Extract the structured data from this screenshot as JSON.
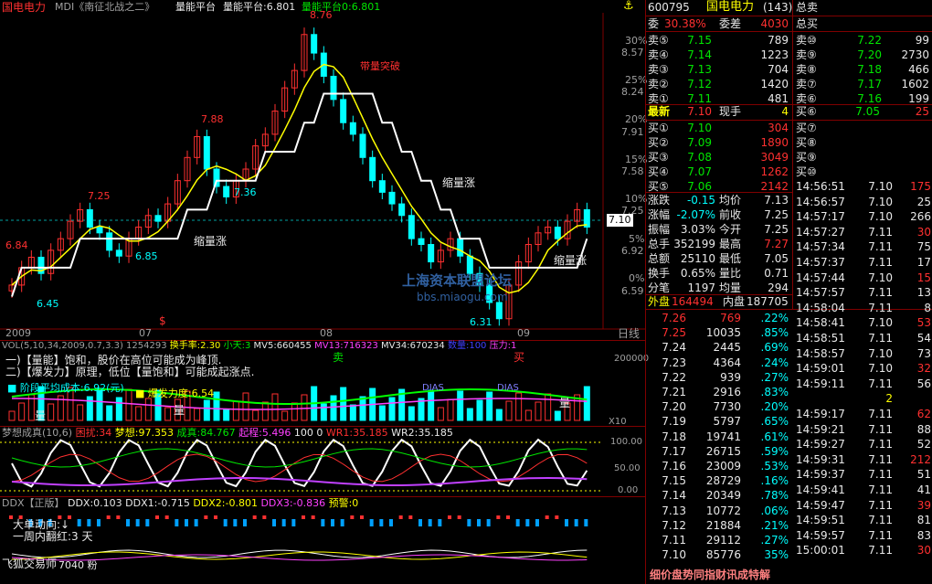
{
  "title_bar": {
    "stock_name": "国电电力",
    "indicator": "MDI《南征北战之二》",
    "platform_label": "量能平台",
    "platform_value": "量能平台:6.801",
    "platform_value2": "量能平台0:6.801",
    "top_right_icon": "anchor-icon"
  },
  "main_chart": {
    "right_scale": [
      "30%",
      "8.57",
      "25%",
      "8.24",
      "20%",
      "7.91",
      "15%",
      "7.58",
      "10%",
      "7.25",
      "5%",
      "6.92",
      "0%",
      "6.59"
    ],
    "price_marker": "7.10",
    "labels": {
      "high_876": "8.76",
      "l788": "7.88",
      "l736": "7.36",
      "l725": "7.25",
      "l684": "6.84",
      "l685": "6.85",
      "l645": "6.45",
      "l631": "6.31",
      "txt_shrink1": "缩量涨",
      "txt_shrink2": "缩量涨",
      "txt_shrink3": "缩量涨",
      "txt_platform": "带量突破",
      "watermark1": "上海资本联盟论坛",
      "watermark2": "bbs.miaogu.com",
      "dollar": "$"
    },
    "x_labels": [
      "2009",
      "07",
      "08",
      "09"
    ],
    "daily": "日线",
    "chart_data": {
      "type": "candlestick",
      "y_range": [
        6.3,
        8.9
      ],
      "close": [
        6.6,
        6.75,
        6.84,
        6.7,
        6.9,
        7.0,
        7.15,
        7.25,
        7.1,
        7.05,
        6.9,
        6.85,
        7.0,
        7.1,
        7.2,
        7.15,
        7.3,
        7.5,
        7.7,
        7.88,
        7.6,
        7.45,
        7.36,
        7.5,
        7.6,
        7.8,
        7.9,
        8.1,
        8.3,
        8.45,
        8.76,
        8.6,
        8.4,
        8.2,
        8.0,
        7.9,
        7.7,
        7.5,
        7.4,
        7.3,
        7.2,
        7.0,
        6.95,
        6.8,
        6.9,
        7.0,
        6.85,
        6.7,
        6.6,
        6.45,
        6.31,
        6.6,
        6.8,
        6.95,
        7.05,
        7.1,
        7.0,
        7.15,
        7.25,
        7.1
      ]
    }
  },
  "vol_panel": {
    "header": "VOL(5,10,34,2009,0.7,3.3) 1254293",
    "turnover": "换手率:2.30",
    "small_days": "小天:3",
    "mv5": "MV5:660455",
    "mv13": "MV13:716323",
    "mv34": "MV34:670234",
    "qty": "数量:100",
    "pressure": "压力:1",
    "line1": "一)【量能】饱和，股价在高位可能成为峰顶.",
    "line2": "二)【爆发力】原理，低位【量饱和】可能成起涨点.",
    "stage_cost": "阶段平均成本:6.92(元)",
    "burst": "爆发力度:6.54",
    "scale_200000": "200000",
    "x10": "X10",
    "sell_label": "卖",
    "sell2": "卖",
    "buy_label": "买",
    "low_label1": "量",
    "low_label2": "量",
    "low_label3": "量",
    "dif_label1": "DIAS",
    "dif_label2": "DIAS"
  },
  "dream_panel": {
    "header": "梦想成真(10,6)",
    "guolu": "困扰:34",
    "dream": "梦想:97.353",
    "cheng": "成真:84.767",
    "qicheng": "起程:5.496",
    "hundred": "100",
    "zero": "0",
    "wr1": "WR1:35.185",
    "wr2": "WR2:35.185",
    "s100": "100.00",
    "s50": "50.00",
    "s0": "0.00"
  },
  "ddx_panel": {
    "header": "DDX【正版】",
    "ddx": "DDX:0.103",
    "ddx1": "DDX1:-0.715",
    "ddx2": "DDX2:-0.801",
    "ddx3": "DDX3:-0.836",
    "warn": "预警:0",
    "big_move": "大单动向:↓",
    "week_red": "一周内翻红:3 天",
    "trader": "飞狐交易师",
    "trader_val": "7040 粉"
  },
  "quote": {
    "code": "600795",
    "name": "国电电力",
    "name_count": "(143)",
    "total_sell": "总卖",
    "wei_bi_label": "委",
    "wei_bi": "30.38%",
    "wei_cha_label": "委差",
    "wei_cha": "4030",
    "total_buy": "总买",
    "sells": [
      {
        "l": "卖⑤",
        "p": "7.15",
        "v": "789"
      },
      {
        "l": "卖④",
        "p": "7.14",
        "v": "1223"
      },
      {
        "l": "卖③",
        "p": "7.13",
        "v": "704"
      },
      {
        "l": "卖②",
        "p": "7.12",
        "v": "1420"
      },
      {
        "l": "卖①",
        "p": "7.11",
        "v": "481"
      }
    ],
    "sells_r": [
      {
        "l": "卖⑩",
        "p": "7.22",
        "v": "99"
      },
      {
        "l": "卖⑨",
        "p": "7.20",
        "v": "2730"
      },
      {
        "l": "卖⑧",
        "p": "7.18",
        "v": "466"
      },
      {
        "l": "卖⑦",
        "p": "7.17",
        "v": "1602"
      },
      {
        "l": "卖⑥",
        "p": "7.16",
        "v": "199"
      }
    ],
    "latest_label": "最新",
    "latest": "7.10",
    "hand_label": "现手",
    "hand": "4",
    "buy6": {
      "l": "买⑥",
      "p": "7.05",
      "v": "25"
    },
    "buys": [
      {
        "l": "买①",
        "p": "7.10",
        "v": "304"
      },
      {
        "l": "买②",
        "p": "7.09",
        "v": "1890"
      },
      {
        "l": "买③",
        "p": "7.08",
        "v": "3049"
      },
      {
        "l": "买④",
        "p": "7.07",
        "v": "1262"
      },
      {
        "l": "买⑤",
        "p": "7.06",
        "v": "2142"
      }
    ],
    "buys_r": [
      "买⑦",
      "买⑧",
      "买⑨",
      "买⑩"
    ],
    "stats": [
      {
        "a": "涨跌",
        "av": "-0.15",
        "b": "均价",
        "bv": "7.13"
      },
      {
        "a": "涨幅",
        "av": "-2.07%",
        "b": "前收",
        "bv": "7.25"
      },
      {
        "a": "振幅",
        "av": "3.03%",
        "b": "今开",
        "bv": "7.25"
      },
      {
        "a": "总手",
        "av": "352199",
        "b": "最高",
        "bv": "7.27"
      },
      {
        "a": "总额",
        "av": "25110",
        "b": "最低",
        "bv": "7.05"
      },
      {
        "a": "换手",
        "av": "0.65%",
        "b": "量比",
        "bv": "0.71"
      },
      {
        "a": "分笔",
        "av": "1197",
        "b": "均量",
        "bv": "294"
      }
    ],
    "outer_label": "外盘",
    "outer": "164494",
    "inner_label": "内盘",
    "inner": "187705",
    "depth": [
      {
        "p": "7.26",
        "v": "769",
        "r": ".22%"
      },
      {
        "p": "7.25",
        "v": "10035",
        "r": ".85%"
      },
      {
        "p": "7.24",
        "v": "2445",
        "r": ".69%"
      },
      {
        "p": "7.23",
        "v": "4364",
        "r": ".24%"
      },
      {
        "p": "7.22",
        "v": "939",
        "r": ".27%"
      },
      {
        "p": "7.21",
        "v": "2916",
        "r": ".83%"
      },
      {
        "p": "7.20",
        "v": "7730",
        "r": ".20%"
      },
      {
        "p": "7.19",
        "v": "5797",
        "r": ".65%"
      },
      {
        "p": "7.18",
        "v": "19741",
        "r": ".61%"
      },
      {
        "p": "7.17",
        "v": "26715",
        "r": ".59%"
      },
      {
        "p": "7.16",
        "v": "23009",
        "r": ".53%"
      },
      {
        "p": "7.15",
        "v": "28729",
        "r": ".16%"
      },
      {
        "p": "7.14",
        "v": "20349",
        "r": ".78%"
      },
      {
        "p": "7.13",
        "v": "10772",
        "r": ".06%"
      },
      {
        "p": "7.12",
        "v": "21884",
        "r": ".21%"
      },
      {
        "p": "7.11",
        "v": "29112",
        "r": ".27%"
      },
      {
        "p": "7.10",
        "v": "85776",
        "r": "35%"
      }
    ],
    "ticks": [
      {
        "t": "14:56:51",
        "p": "7.10",
        "v": "175"
      },
      {
        "t": "14:56:57",
        "p": "7.10",
        "v": "25"
      },
      {
        "t": "14:57:17",
        "p": "7.10",
        "v": "266"
      },
      {
        "t": "14:57:27",
        "p": "7.11",
        "v": "30"
      },
      {
        "t": "14:57:34",
        "p": "7.11",
        "v": "75"
      },
      {
        "t": "14:57:37",
        "p": "7.11",
        "v": "17"
      },
      {
        "t": "14:57:44",
        "p": "7.10",
        "v": "15"
      },
      {
        "t": "14:57:57",
        "p": "7.11",
        "v": "13"
      },
      {
        "t": "14:58:04",
        "p": "7.11",
        "v": "8"
      },
      {
        "t": "14:58:41",
        "p": "7.10",
        "v": "53"
      },
      {
        "t": "14:58:51",
        "p": "7.11",
        "v": "54"
      },
      {
        "t": "14:58:57",
        "p": "7.10",
        "v": "73"
      },
      {
        "t": "14:59:01",
        "p": "7.10",
        "v": "32"
      },
      {
        "t": "14:59:11",
        "p": "7.11",
        "v": "56"
      },
      {
        "t": "",
        "p": "2",
        "v": ""
      },
      {
        "t": "14:59:17",
        "p": "7.11",
        "v": "62"
      },
      {
        "t": "14:59:21",
        "p": "7.11",
        "v": "88"
      },
      {
        "t": "14:59:27",
        "p": "7.11",
        "v": "52"
      },
      {
        "t": "14:59:31",
        "p": "7.11",
        "v": "212"
      },
      {
        "t": "14:59:37",
        "p": "7.11",
        "v": "51"
      },
      {
        "t": "14:59:41",
        "p": "7.11",
        "v": "41"
      },
      {
        "t": "14:59:47",
        "p": "7.11",
        "v": "39"
      },
      {
        "t": "14:59:51",
        "p": "7.11",
        "v": "81"
      },
      {
        "t": "14:59:57",
        "p": "7.11",
        "v": "83"
      },
      {
        "t": "15:00:01",
        "p": "7.11",
        "v": "30"
      }
    ],
    "footer": "细价盘势同指财讯成特解"
  },
  "colors": {
    "up": "#ff3030",
    "down": "#00ffff",
    "bg": "#000000",
    "grid": "#800000"
  }
}
